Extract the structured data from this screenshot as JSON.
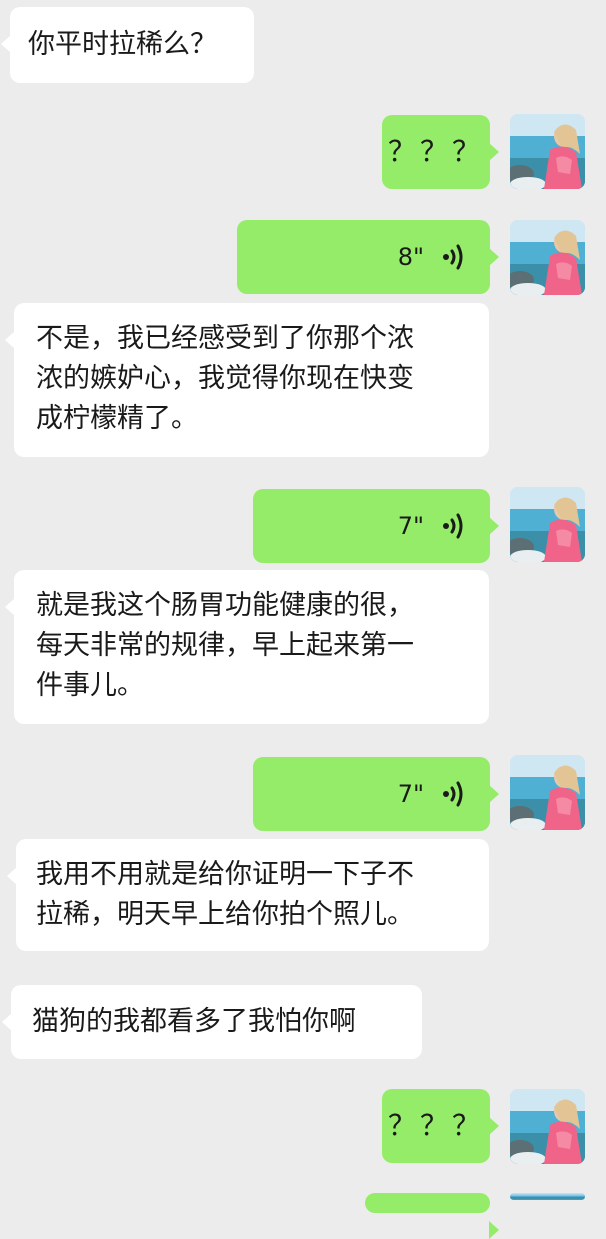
{
  "chat": {
    "messages": [
      {
        "side": "left",
        "type": "text",
        "text": "你平时拉稀么？"
      },
      {
        "side": "right",
        "type": "text",
        "text": "？？？"
      },
      {
        "side": "right",
        "type": "voice",
        "duration": "8\""
      },
      {
        "side": "left",
        "type": "text",
        "text": "不是，我已经感受到了你那个浓\n浓的嫉妒心，我觉得你现在快变\n成柠檬精了。"
      },
      {
        "side": "right",
        "type": "voice",
        "duration": "7\""
      },
      {
        "side": "left",
        "type": "text",
        "text": "就是我这个肠胃功能健康的很，\n每天非常的规律，早上起来第一\n件事儿。"
      },
      {
        "side": "right",
        "type": "voice",
        "duration": "7\""
      },
      {
        "side": "left",
        "type": "text",
        "text": "我用不用就是给你证明一下子不\n拉稀，明天早上给你拍个照儿。"
      },
      {
        "side": "left",
        "type": "text",
        "text": "猫狗的我都看多了我怕你啊"
      },
      {
        "side": "right",
        "type": "text",
        "text": "？？？"
      }
    ]
  },
  "colors": {
    "background": "#ececec",
    "left_bubble": "#ffffff",
    "right_bubble": "#95ec69"
  },
  "icons": {
    "voice": "voice-wave-icon",
    "avatar": "avatar-beach-photo"
  }
}
